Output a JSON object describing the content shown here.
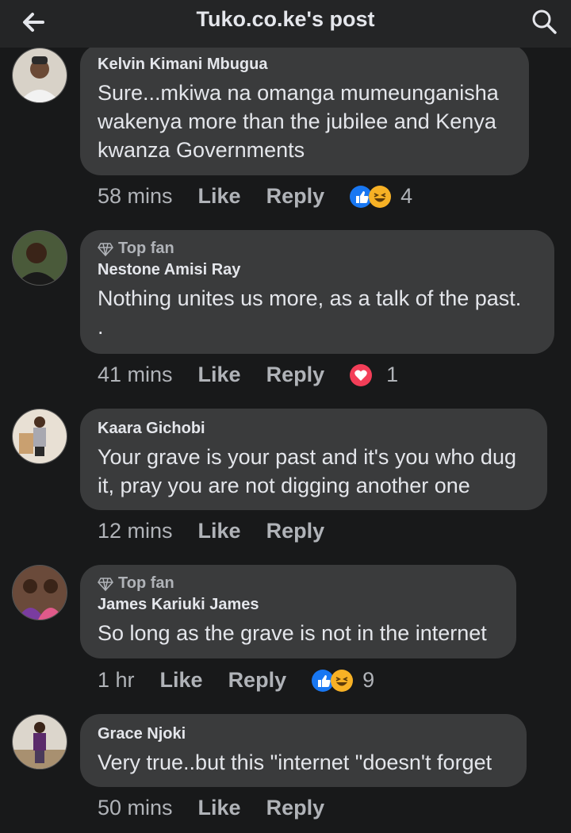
{
  "header": {
    "title": "Tuko.co.ke's post"
  },
  "labels": {
    "like": "Like",
    "reply": "Reply",
    "top_fan": "Top fan"
  },
  "comments": [
    {
      "author": "Kelvin Kimani Mbugua",
      "top_fan": false,
      "text": "Sure...mkiwa na omanga mumeunganisha wakenya more than the jubilee and Kenya kwanza Governments",
      "time": "58 mins",
      "reactions": [
        "like-icon",
        "haha-icon"
      ],
      "reaction_count": "4"
    },
    {
      "author": "Nestone Amisi Ray",
      "top_fan": true,
      "text": "Nothing unites us more, as a talk of the past.",
      "text_line2": ".",
      "time": "41 mins",
      "reactions": [
        "love-icon"
      ],
      "reaction_count": "1"
    },
    {
      "author": "Kaara Gichobi",
      "top_fan": false,
      "text": "Your grave is your past and it's you who dug it, pray you are not digging another one",
      "time": "12 mins",
      "reactions": [],
      "reaction_count": ""
    },
    {
      "author": "James Kariuki James",
      "top_fan": true,
      "text": "So long as the grave is not in the internet",
      "time": "1 hr",
      "reactions": [
        "like-icon",
        "haha-icon"
      ],
      "reaction_count": "9"
    },
    {
      "author": "Grace Njoki",
      "top_fan": false,
      "text": "Very true..but this \"internet \"doesn't forget",
      "time": "50 mins",
      "reactions": [],
      "reaction_count": ""
    }
  ],
  "colors": {
    "background": "#18191a",
    "header": "#242526",
    "bubble": "#3a3b3c",
    "like_blue": "#1877f2",
    "love_red": "#f33e58",
    "haha_yellow": "#f7b125"
  }
}
